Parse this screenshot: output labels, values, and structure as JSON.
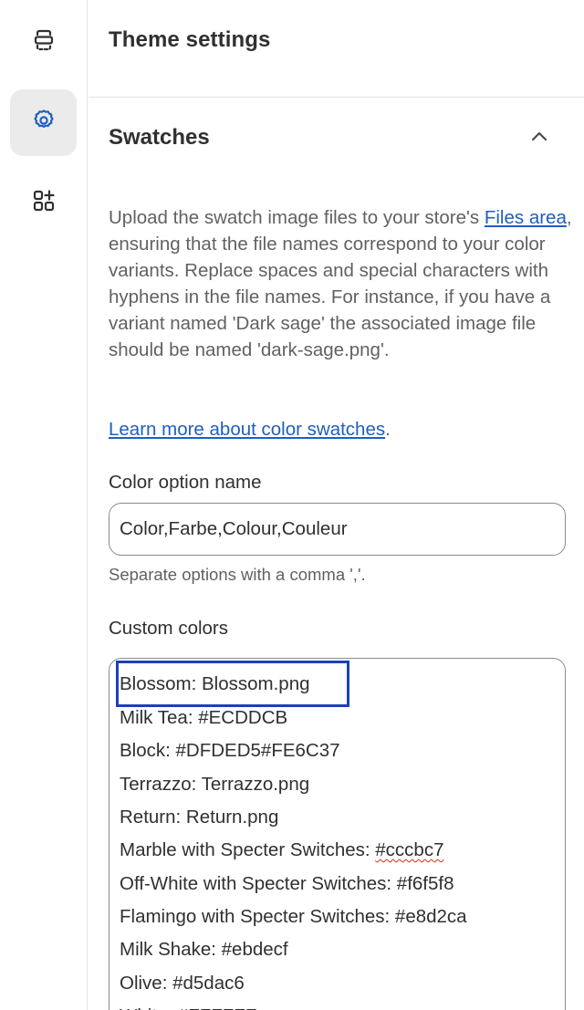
{
  "rail": {
    "items": [
      {
        "icon": "sections-icon",
        "active": false
      },
      {
        "icon": "gear-icon",
        "active": true
      },
      {
        "icon": "add-app-blocks-icon",
        "active": false
      }
    ]
  },
  "header": {
    "title": "Theme settings"
  },
  "section": {
    "title": "Swatches",
    "collapse_icon": "chevron-up-icon",
    "description_before_link": "Upload the swatch image files to your store's ",
    "files_link": "Files area",
    "description_after_link": ", ensuring that the file names correspond to your color variants. Replace spaces and special characters with hyphens in the file names. For instance, if you have a variant named 'Dark sage' the associated image file should be named 'dark-sage.png'.",
    "learn_more_link": "Learn more about color swatches",
    "learn_more_suffix": "."
  },
  "color_option": {
    "label": "Color option name",
    "value": "Color,Farbe,Colour,Couleur",
    "help": "Separate options with a comma ','."
  },
  "custom_colors": {
    "label": "Custom colors",
    "lines": [
      "Blossom: Blossom.png",
      "Milk Tea: #ECDDCB",
      "Block: #DFDED5#FE6C37",
      "Terrazzo: Terrazzo.png",
      "Return: Return.png",
      "Marble with Specter Switches: ",
      "Off-White with Specter Switches: #f6f5f8",
      "Flamingo with Specter Switches: #e8d2ca",
      "Milk Shake: #ebdecf",
      "Olive: #d5dac6",
      "White: #FFFFFF"
    ],
    "misspelled_token": "#cccbc7",
    "highlighted_line_index": 0,
    "highlight_color": "#1d3fbb"
  },
  "colors": {
    "link": "#1f5fbf",
    "text": "#303030",
    "muted": "#616161",
    "spellcheck": "#d72c0d"
  }
}
